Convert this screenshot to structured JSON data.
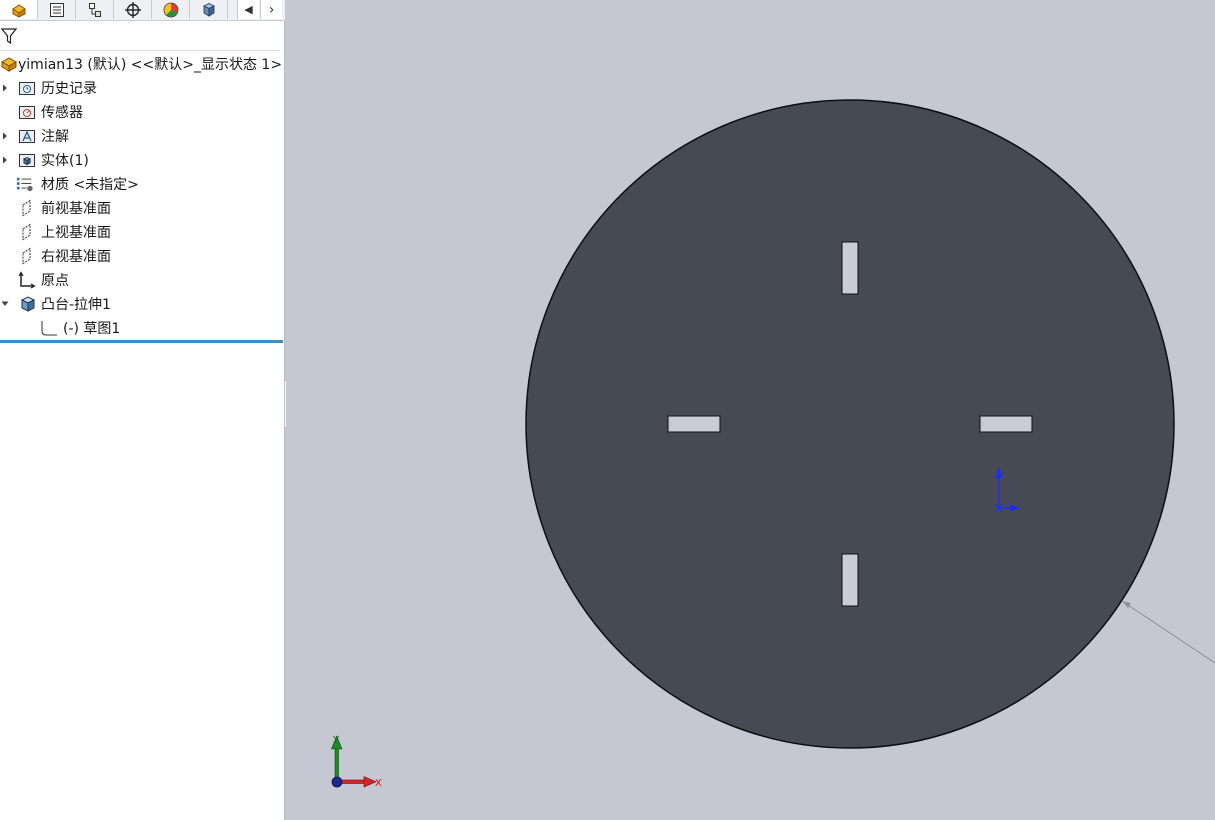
{
  "tabs": [
    {
      "name": "featuremanager-tab",
      "icon": "part-tree-icon"
    },
    {
      "name": "propertymanager-tab",
      "icon": "property-list-icon"
    },
    {
      "name": "configurationmanager-tab",
      "icon": "configuration-icon"
    },
    {
      "name": "dimxpertmanager-tab",
      "icon": "crosshair-icon"
    },
    {
      "name": "displaymanager-tab",
      "icon": "color-wheel-icon"
    },
    {
      "name": "cam-tab",
      "icon": "cube-icon"
    }
  ],
  "tree": {
    "root_label": "yimian13 (默认) <<默认>_显示状态 1>",
    "items": [
      {
        "label": "历史记录",
        "icon": "history-folder-icon",
        "expandable": true
      },
      {
        "label": "传感器",
        "icon": "sensor-icon",
        "expandable": false
      },
      {
        "label": "注解",
        "icon": "annotation-icon",
        "expandable": true
      },
      {
        "label": "实体(1)",
        "icon": "solid-body-icon",
        "expandable": true
      },
      {
        "label": "材质 <未指定>",
        "icon": "material-icon",
        "expandable": false
      },
      {
        "label": "前视基准面",
        "icon": "plane-icon",
        "expandable": false
      },
      {
        "label": "上视基准面",
        "icon": "plane-icon",
        "expandable": false
      },
      {
        "label": "右视基准面",
        "icon": "plane-icon",
        "expandable": false
      },
      {
        "label": "原点",
        "icon": "origin-icon",
        "expandable": false
      },
      {
        "label": "凸台-拉伸1",
        "icon": "extrude-icon",
        "expandable": true,
        "expanded": true
      },
      {
        "label": "(-) 草图1",
        "icon": "sketch-icon",
        "expandable": false,
        "child": true
      }
    ]
  },
  "viewport": {
    "background": "#c5c8d2",
    "disk_color": "#464a55",
    "slot_color": "#c9ccd6",
    "triad_labels": {
      "x": "X",
      "y": "Y"
    }
  }
}
